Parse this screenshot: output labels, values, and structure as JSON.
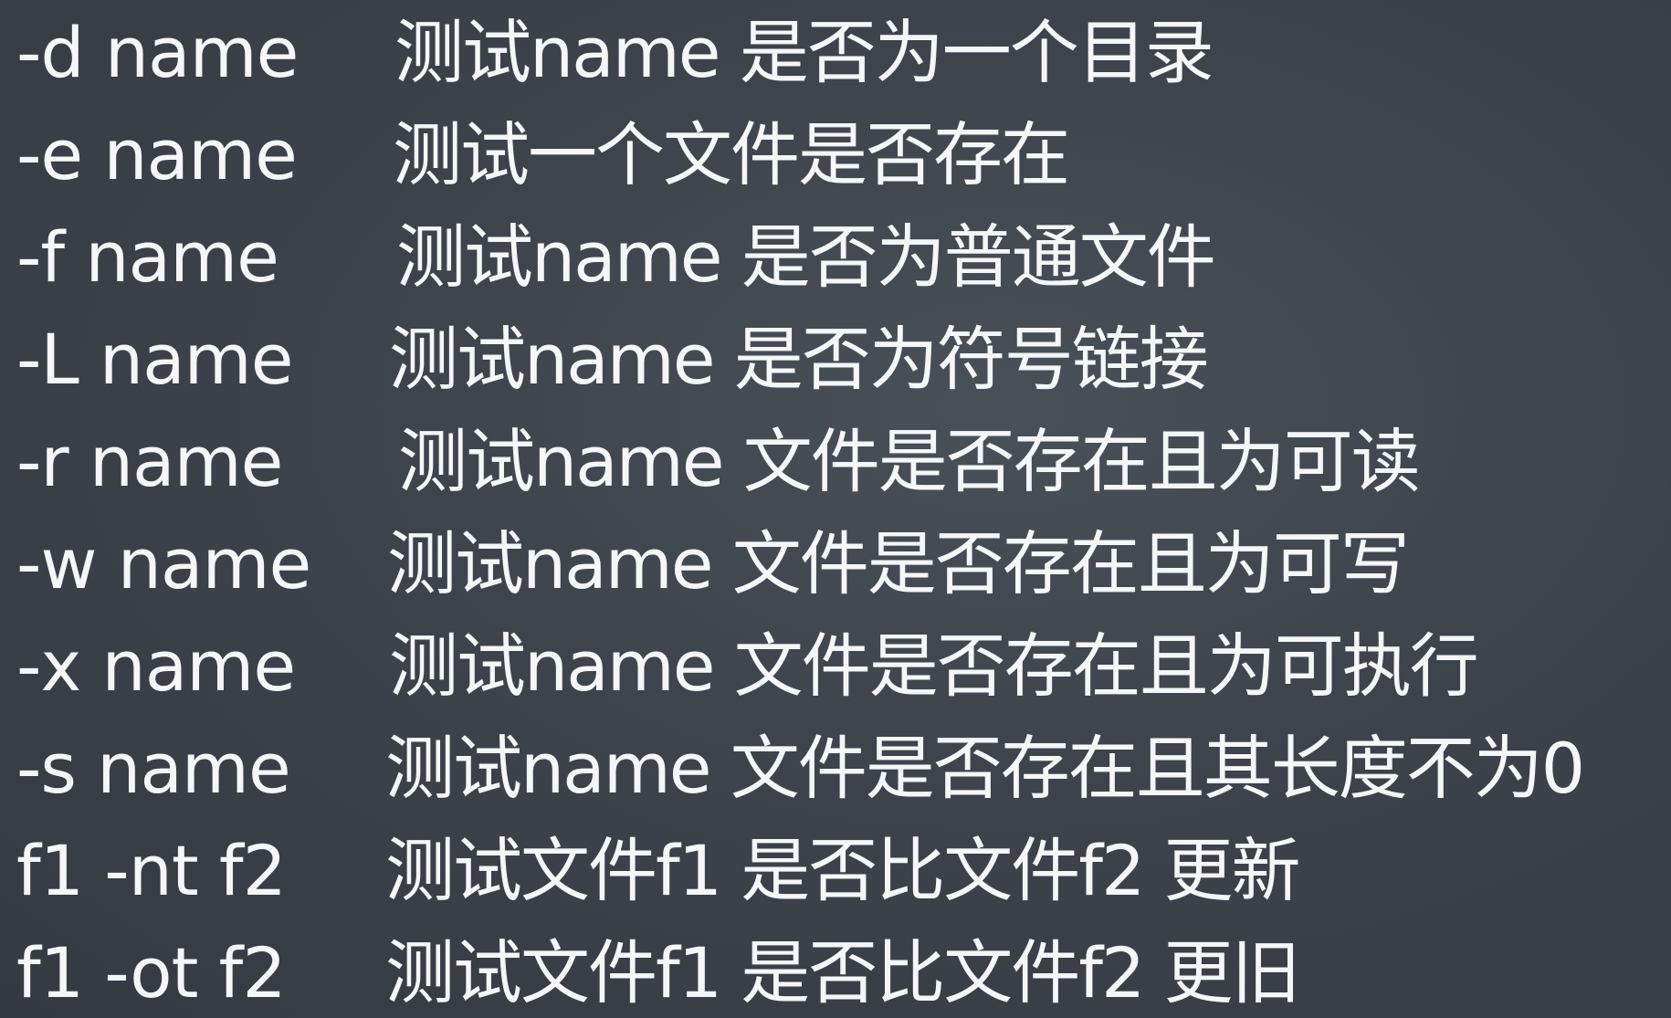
{
  "rows": [
    {
      "flag": "-d name",
      "desc": "测试name 是否为一个目录"
    },
    {
      "flag": "-e name",
      "desc": "测试一个文件是否存在"
    },
    {
      "flag": "-f name",
      "desc": "测试name 是否为普通文件"
    },
    {
      "flag": "-L name",
      "desc": "测试name 是否为符号链接"
    },
    {
      "flag": "-r name",
      "desc": "测试name 文件是否存在且为可读"
    },
    {
      "flag": "-w name",
      "desc": "测试name 文件是否存在且为可写"
    },
    {
      "flag": "-x name",
      "desc": "测试name 文件是否存在且为可执行"
    },
    {
      "flag": "-s name",
      "desc": "测试name 文件是否存在且其长度不为0"
    },
    {
      "flag": "f1 -nt f2",
      "desc": "测试文件f1 是否比文件f2 更新"
    },
    {
      "flag": "f1 -ot f2",
      "desc": "测试文件f1 是否比文件f2 更旧"
    }
  ]
}
